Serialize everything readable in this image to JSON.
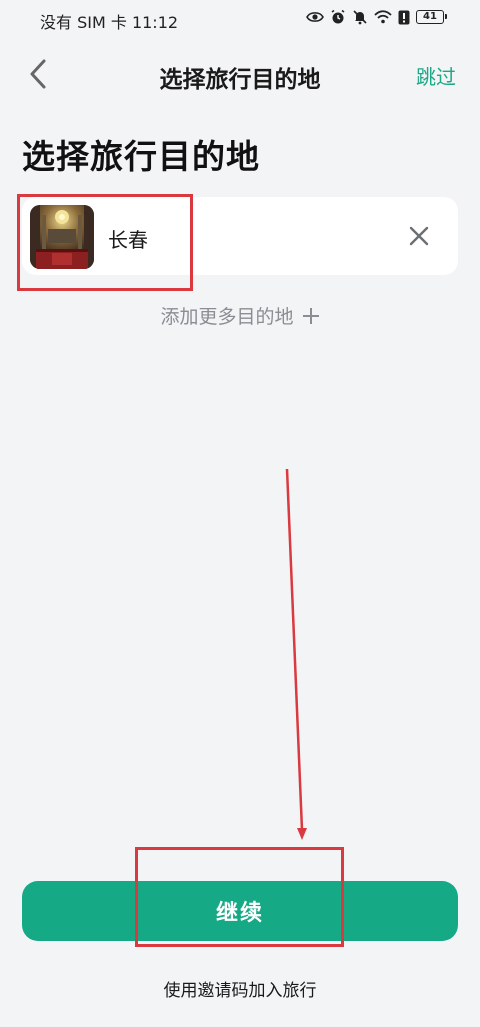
{
  "status_bar": {
    "carrier_time": "没有 SIM 卡 11:12",
    "battery": "41",
    "icons": [
      "eye-icon",
      "alarm-icon",
      "mute-icon",
      "wifi-icon",
      "alert-icon",
      "battery-icon"
    ]
  },
  "nav": {
    "title": "选择旅行目的地",
    "skip_label": "跳过",
    "back_icon": "chevron-left-icon"
  },
  "page": {
    "heading": "选择旅行目的地"
  },
  "destinations": [
    {
      "name": "长春",
      "thumb_icon": "city-photo"
    }
  ],
  "add_more": {
    "label": "添加更多目的地",
    "icon": "plus-icon"
  },
  "actions": {
    "continue_label": "继续",
    "invite_label": "使用邀请码加入旅行"
  },
  "colors": {
    "accent": "#15a986",
    "background": "#f3f4f6",
    "annotation": "#d9393f"
  }
}
